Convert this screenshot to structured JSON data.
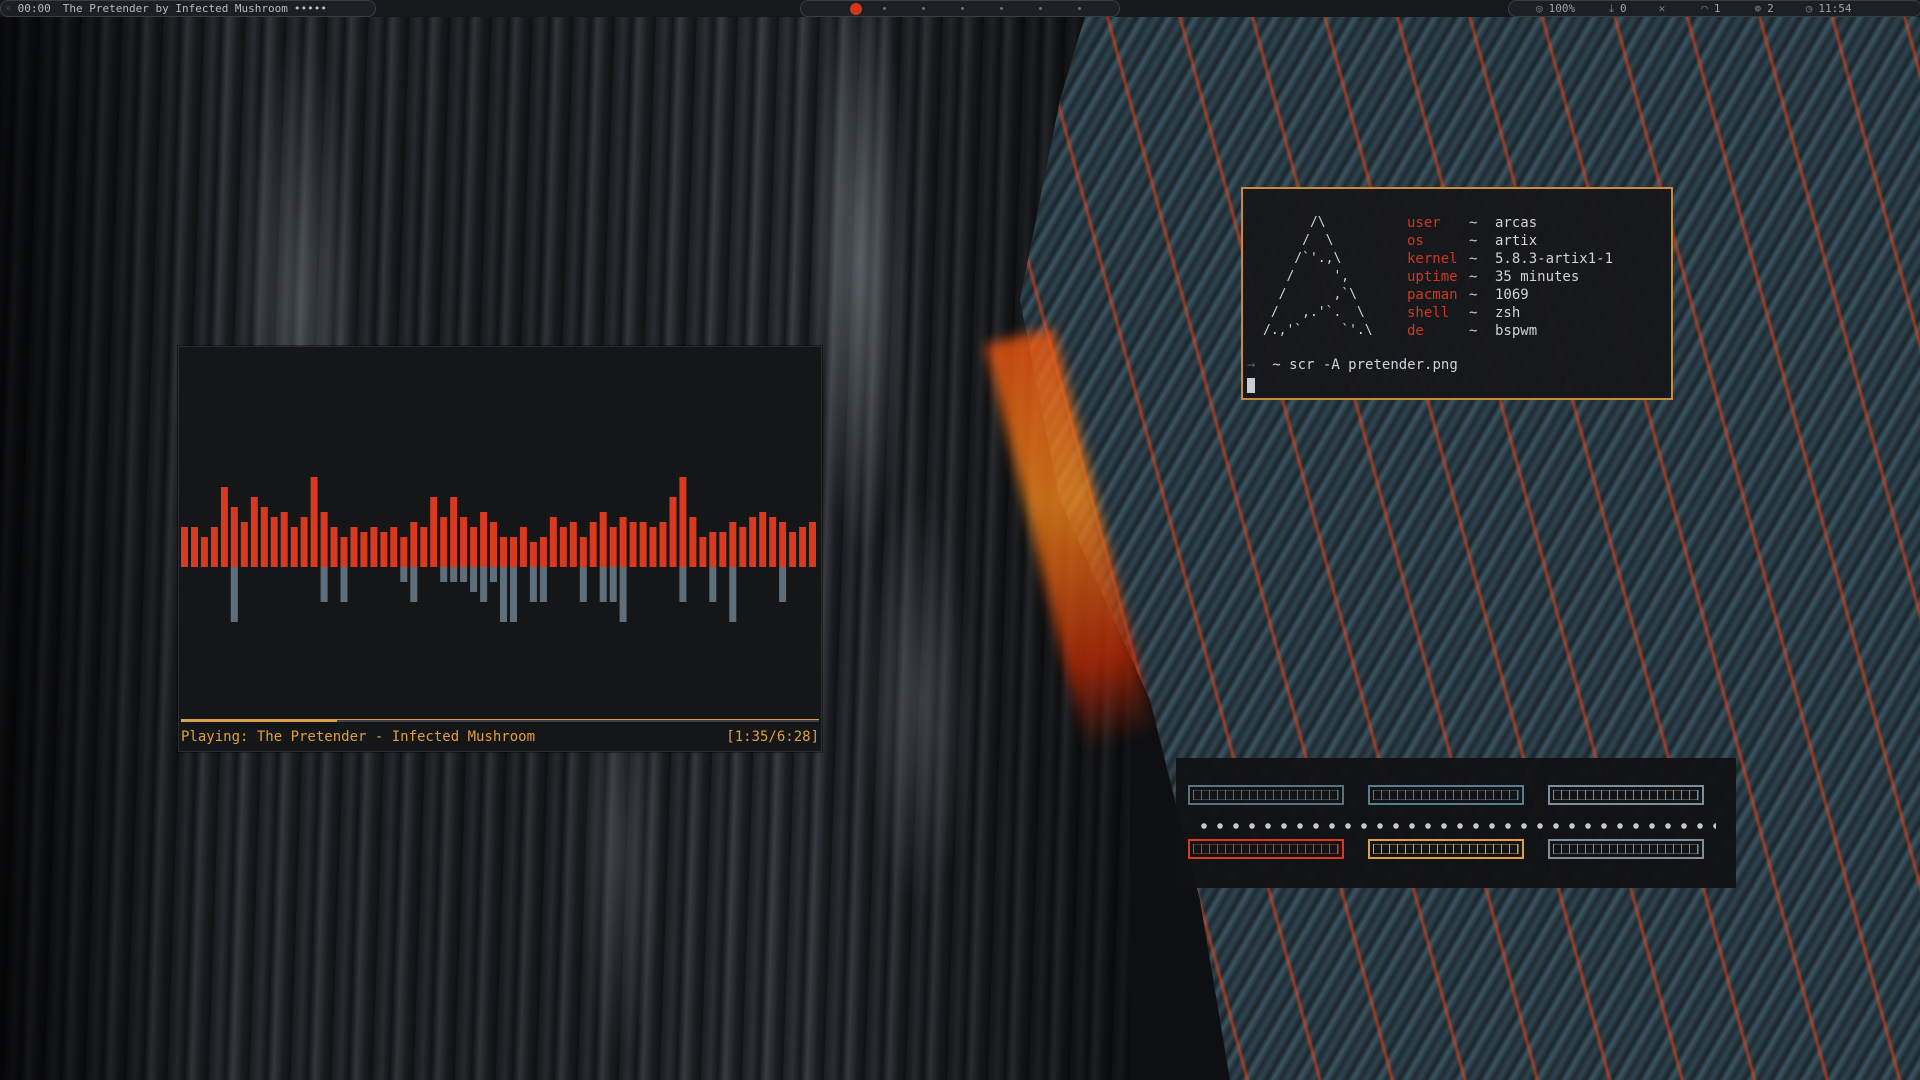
{
  "topbar": {
    "clock_left": "00:00",
    "window_title": "The Pretender by Infected Mushroom",
    "title_suffix": "•••••",
    "workspaces": {
      "active_color": "#d2361e",
      "count": 7
    },
    "status": {
      "volume": "100%",
      "downloads": "0",
      "wifi": "1",
      "updates": "2",
      "clock_right": "11:54"
    }
  },
  "visualizer": {
    "now_playing": "Playing: The Pretender - Infected Mushroom",
    "time": "[1:35/6:28]",
    "progress": 0.245,
    "colors": {
      "bar_top": "#d8391f",
      "bar_bottom": "#5e6e7a",
      "accent": "#e0a040"
    },
    "bars_top": [
      40,
      40,
      30,
      40,
      80,
      60,
      45,
      70,
      60,
      50,
      55,
      40,
      50,
      90,
      55,
      40,
      30,
      40,
      35,
      40,
      35,
      40,
      30,
      45,
      40,
      70,
      50,
      70,
      50,
      40,
      55,
      45,
      30,
      30,
      40,
      25,
      30,
      50,
      40,
      45,
      30,
      45,
      55,
      40,
      50,
      45,
      45,
      40,
      45,
      70,
      90,
      50,
      30,
      35,
      35,
      45,
      40,
      50,
      55,
      50,
      45,
      35,
      40,
      45
    ],
    "bars_bottom": [
      0,
      0,
      0,
      0,
      0,
      55,
      0,
      0,
      0,
      0,
      0,
      0,
      0,
      0,
      35,
      0,
      35,
      0,
      0,
      0,
      0,
      0,
      15,
      35,
      0,
      0,
      15,
      15,
      15,
      25,
      35,
      15,
      55,
      55,
      0,
      35,
      35,
      0,
      0,
      0,
      35,
      0,
      35,
      35,
      55,
      0,
      0,
      0,
      0,
      0,
      35,
      0,
      0,
      35,
      0,
      55,
      0,
      0,
      0,
      0,
      35,
      0,
      0,
      0
    ]
  },
  "terminal": {
    "ascii_art": "      /\\\n     /  \\\n    /`'.,\\\n   /     ',\n  /      ,`\\\n /   ,.'`.  \\\n/.,'`     `'.\\",
    "info": [
      {
        "key": "user",
        "value": "arcas"
      },
      {
        "key": "os",
        "value": "artix"
      },
      {
        "key": "kernel",
        "value": "5.8.3-artix1-1"
      },
      {
        "key": "uptime",
        "value": "35 minutes"
      },
      {
        "key": "pacman",
        "value": "1069"
      },
      {
        "key": "shell",
        "value": "zsh"
      },
      {
        "key": "de",
        "value": "bspwm"
      }
    ],
    "separator": "~",
    "prompt_arrow": "→",
    "prompt_dir": "~",
    "command": "scr -A pretender.png"
  },
  "palette": {
    "row1": [
      "#5a7280",
      "#5a7d8e",
      "#7e8e9a"
    ],
    "row2": [
      "#d8391f",
      "#e0a040",
      "#7e8e9a"
    ]
  }
}
